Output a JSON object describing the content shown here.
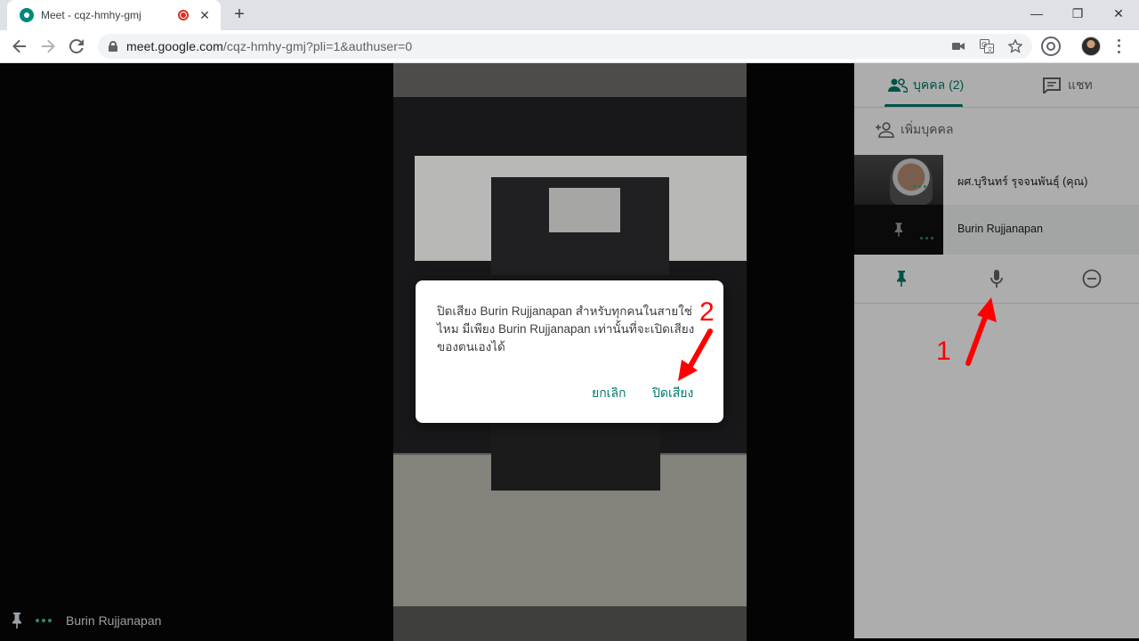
{
  "browser": {
    "tab_title": "Meet - cqz-hmhy-gmj",
    "new_tab": "+",
    "url_host": "meet.google.com",
    "url_path": "/cqz-hmhy-gmj?pli=1&authuser=0",
    "window_controls": {
      "minimize": "—",
      "restore": "❐",
      "close": "✕"
    }
  },
  "stage": {
    "bottom_participant": "Burin Rujjanapan"
  },
  "panel": {
    "tab_people": "บุคคล (2)",
    "tab_chat": "แชท",
    "add_people": "เพิ่มบุคคล",
    "participants": [
      {
        "name": "ผศ.บุรินทร์ รุจจนพันธุ์ (คุณ)"
      },
      {
        "name": "Burin Rujjanapan"
      }
    ]
  },
  "dialog": {
    "message": "ปิดเสียง Burin Rujjanapan สำหรับทุกคนในสายใช่ไหม มีเพียง Burin Rujjanapan เท่านั้นที่จะเปิดเสียงของตนเองได้",
    "cancel": "ยกเลิก",
    "confirm": "ปิดเสียง"
  },
  "annotations": {
    "step1": "1",
    "step2": "2"
  },
  "colors": {
    "accent": "#00796b",
    "annotation": "#ff0000",
    "recording": "#d93025"
  }
}
